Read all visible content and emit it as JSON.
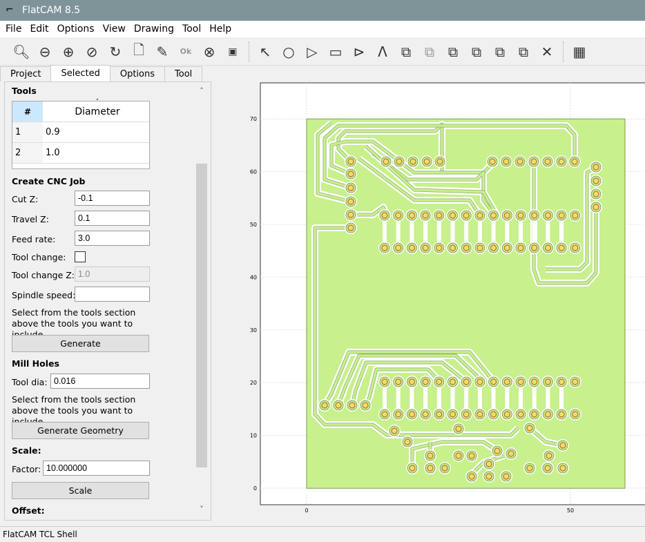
{
  "window": {
    "title": "FlatCAM 8.5"
  },
  "menu": [
    "File",
    "Edit",
    "Options",
    "View",
    "Drawing",
    "Tool",
    "Help"
  ],
  "toolbar": {
    "icons": [
      "zoom-fit-icon",
      "zoom-out-icon",
      "zoom-in-icon",
      "clear-plot-icon",
      "replot-icon",
      "new-project-icon",
      "edit-icon",
      "ok-icon",
      "delete-icon",
      "shell-icon",
      "select-icon",
      "circle-icon",
      "arc-icon",
      "rectangle-icon",
      "polygon-icon",
      "path-icon",
      "union-icon",
      "intersection-icon",
      "subtraction-icon",
      "cut-icon",
      "move-icon",
      "copy-icon",
      "delete-shape-icon",
      "grid-icon"
    ]
  },
  "tabs": [
    "Project",
    "Selected",
    "Options",
    "Tool"
  ],
  "panel": {
    "tools_heading": "Tools",
    "table": {
      "headers": [
        "#",
        "Diameter"
      ],
      "rows": [
        [
          "1",
          "0.9"
        ],
        [
          "2",
          "1.0"
        ]
      ]
    },
    "cnc_heading": "Create CNC Job",
    "cut_z_label": "Cut Z:",
    "cut_z": "-0.1",
    "travel_z_label": "Travel Z:",
    "travel_z": "0.1",
    "feed_label": "Feed rate:",
    "feed": "3.0",
    "toolchange_label": "Tool change:",
    "toolchange_z_label": "Tool change Z:",
    "toolchange_z": "1.0",
    "spindle_label": "Spindle speed:",
    "spindle": "",
    "hint1": "Select from the tools section above the tools you want to include.",
    "generate": "Generate",
    "mill_heading": "Mill Holes",
    "tooldia_label": "Tool dia:",
    "tooldia": "0.016",
    "hint2": "Select from the tools section above the tools you want to include.",
    "generate_geometry": "Generate Geometry",
    "scale_heading": "Scale:",
    "factor_label": "Factor:",
    "factor": "10.000000",
    "scale_btn": "Scale",
    "offset_heading": "Offset:"
  },
  "plot": {
    "y_ticks": [
      "0",
      "10",
      "20",
      "30",
      "40",
      "50",
      "60",
      "70"
    ],
    "x_ticks": [
      "0",
      "50"
    ],
    "board_color": "#c8f08c"
  },
  "status": "FlatCAM TCL Shell"
}
